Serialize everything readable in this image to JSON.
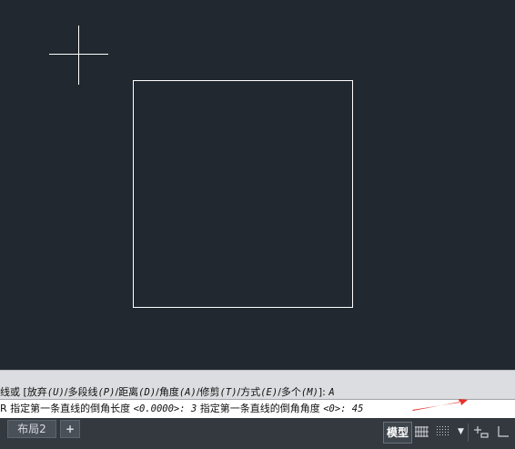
{
  "command_history": {
    "line": [
      {
        "text": "线或 [放弃",
        "italic": false
      },
      {
        "text": "(U)",
        "italic": true
      },
      {
        "text": "/多段线",
        "italic": false
      },
      {
        "text": "(P)",
        "italic": true
      },
      {
        "text": "/距离",
        "italic": false
      },
      {
        "text": "(D)",
        "italic": true
      },
      {
        "text": "/角度",
        "italic": false
      },
      {
        "text": "(A)",
        "italic": true
      },
      {
        "text": "/修剪",
        "italic": false
      },
      {
        "text": "(T)",
        "italic": true
      },
      {
        "text": "/方式",
        "italic": false
      },
      {
        "text": "(E)",
        "italic": true
      },
      {
        "text": "/多个",
        "italic": false
      },
      {
        "text": "(M)",
        "italic": true
      },
      {
        "text": "]: ",
        "italic": false
      },
      {
        "text": " A",
        "italic": true
      }
    ]
  },
  "command_input": {
    "line": [
      {
        "text": "R",
        "italic": false
      },
      {
        "text": " 指定第一条直线的倒角长度 ",
        "italic": false
      },
      {
        "text": "<0.0000>: 3",
        "italic": true
      },
      {
        "text": " 指定第一条直线的倒角角度 ",
        "italic": false
      },
      {
        "text": "<0>: 45",
        "italic": true
      }
    ]
  },
  "layout_tabs": {
    "layout2_label": "布局2",
    "add_label": "+"
  },
  "status_bar": {
    "model_label": "模型",
    "icons": [
      "grid-icon",
      "snap-icon",
      "dropdown-chevron-icon",
      "infer-constraints-icon",
      "ortho-icon"
    ]
  },
  "colors": {
    "canvas_bg": "#212830",
    "drawing_lines": "#ffffff",
    "annotation_arrow": "#e8312a"
  }
}
